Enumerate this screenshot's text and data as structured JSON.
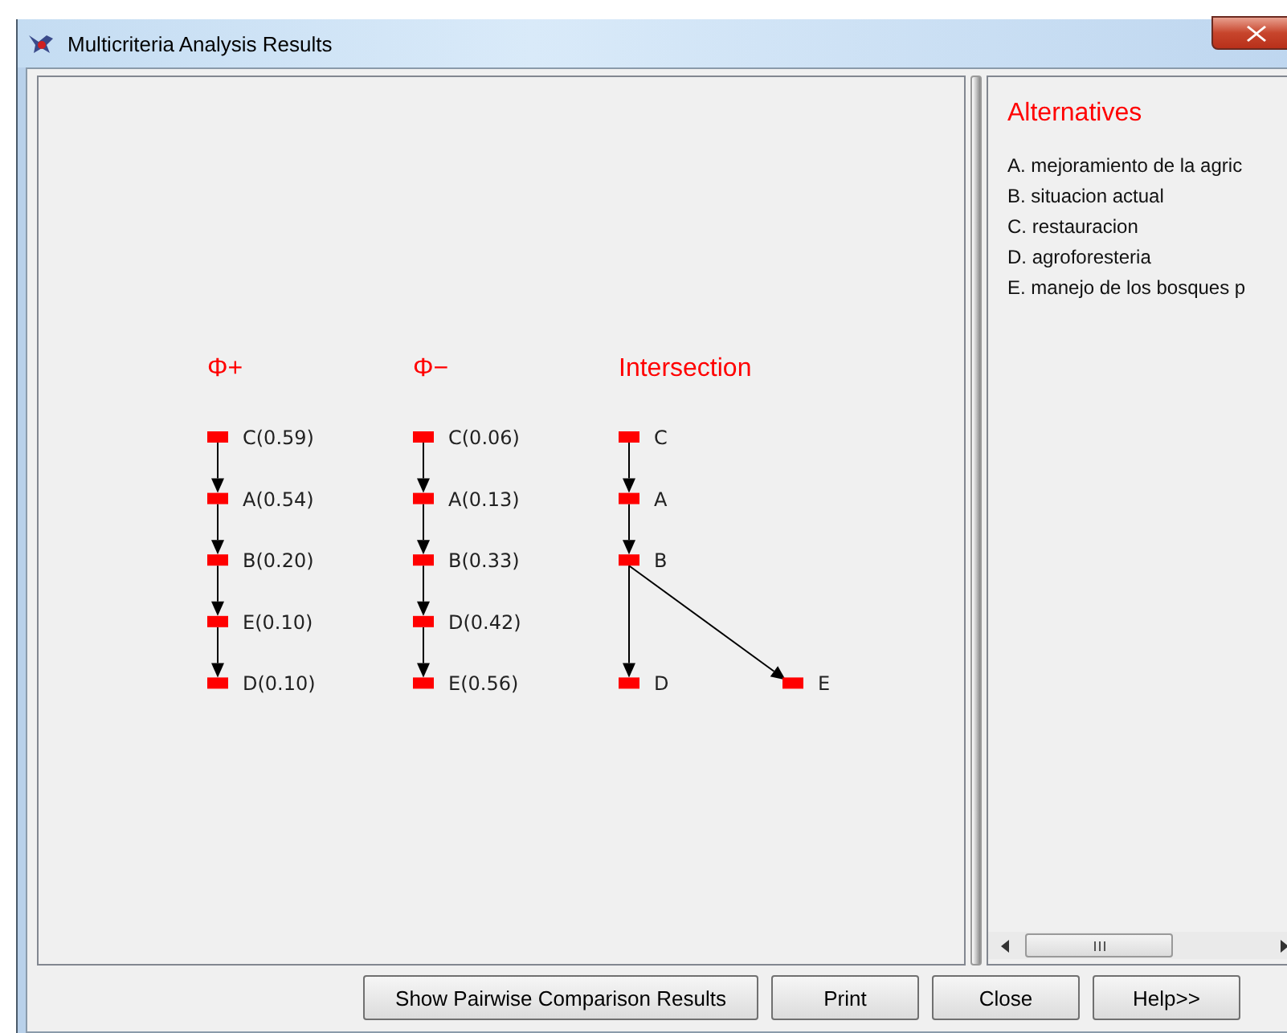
{
  "window": {
    "title": "Multicriteria Analysis Results"
  },
  "graphs": [
    {
      "title": "Φ+",
      "nodes": [
        {
          "label": "C(0.59)",
          "children": [
            {
              "label": "A(0.54)",
              "children": [
                {
                  "label": "B(0.20)",
                  "children": [
                    {
                      "label": "E(0.10)",
                      "children": [
                        {
                          "label": "D(0.10)"
                        }
                      ]
                    }
                  ]
                }
              ]
            }
          ]
        }
      ]
    },
    {
      "title": "Φ−",
      "nodes": [
        {
          "label": "C(0.06)",
          "children": [
            {
              "label": "A(0.13)",
              "children": [
                {
                  "label": "B(0.33)",
                  "children": [
                    {
                      "label": "D(0.42)",
                      "children": [
                        {
                          "label": "E(0.56)"
                        }
                      ]
                    }
                  ]
                }
              ]
            }
          ]
        }
      ]
    },
    {
      "title": "Intersection",
      "nodes": [
        {
          "label": "C",
          "children": [
            {
              "label": "A",
              "children": [
                {
                  "label": "B",
                  "children": [
                    {
                      "label": "D"
                    },
                    {
                      "label": "E"
                    }
                  ]
                }
              ]
            }
          ]
        }
      ]
    }
  ],
  "alternatives": {
    "title": "Alternatives",
    "items": [
      "A. mejoramiento de la agric",
      "B. situacion actual",
      "C. restauracion",
      "D. agroforesteria",
      "E. manejo de los bosques p"
    ]
  },
  "buttons": [
    "Show Pairwise Comparison Results",
    "Print",
    "Close",
    "Help>>"
  ]
}
